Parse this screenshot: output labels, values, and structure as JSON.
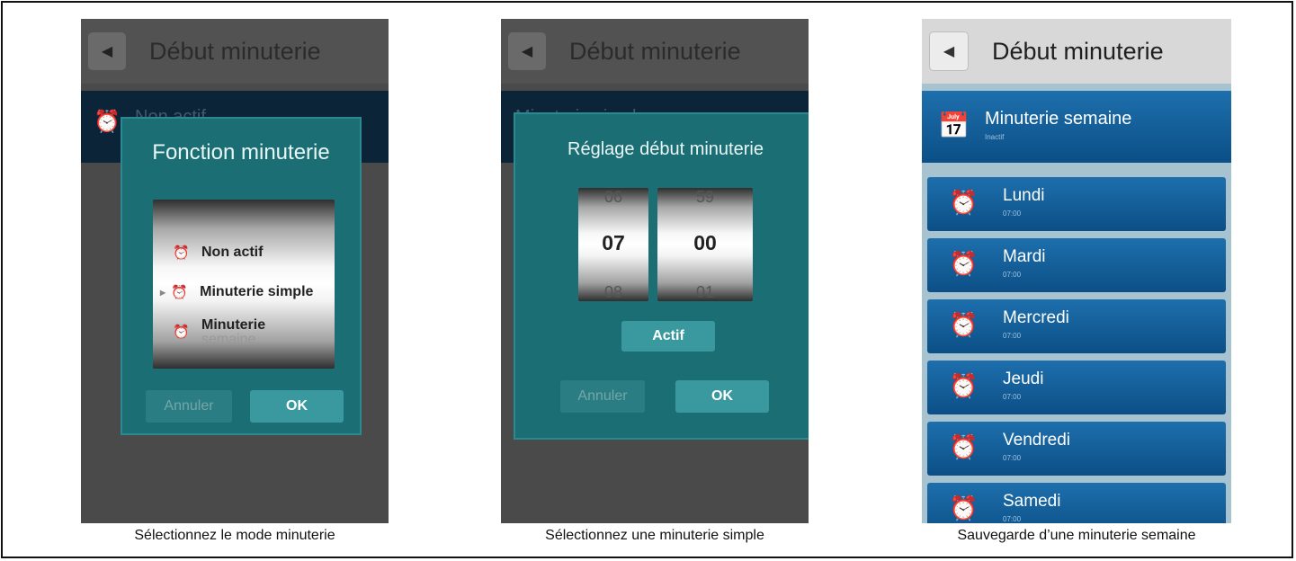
{
  "screen1": {
    "header_title": "Début minuterie",
    "bg_row_text": "Non actif",
    "dialog_title": "Fonction minuterie",
    "options": [
      "Non actif",
      "Minuterie simple",
      "Minuterie",
      "semaine"
    ],
    "cancel": "Annuler",
    "ok": "OK",
    "caption": "Sélectionnez le mode minuterie"
  },
  "screen2": {
    "header_title": "Début minuterie",
    "bg_row_text": "Minuterie simple",
    "dialog_title": "Réglage début minuterie",
    "hour_prev": "06",
    "hour": "07",
    "hour_next": "08",
    "minute_prev": "59",
    "minute": "00",
    "minute_next": "01",
    "actif": "Actif",
    "cancel": "Annuler",
    "ok": "OK",
    "caption": "Sélectionnez une minuterie simple"
  },
  "screen3": {
    "header_title": "Début minuterie",
    "top_row": "Minuterie semaine",
    "top_row_sub": "Inactif",
    "days": [
      {
        "label": "Lundi",
        "time": "07:00"
      },
      {
        "label": "Mardi",
        "time": "07:00"
      },
      {
        "label": "Mercredi",
        "time": "07:00"
      },
      {
        "label": "Jeudi",
        "time": "07:00"
      },
      {
        "label": "Vendredi",
        "time": "07:00"
      },
      {
        "label": "Samedi",
        "time": "07:00"
      }
    ],
    "caption": "Sauvegarde d’une minuterie semaine"
  }
}
